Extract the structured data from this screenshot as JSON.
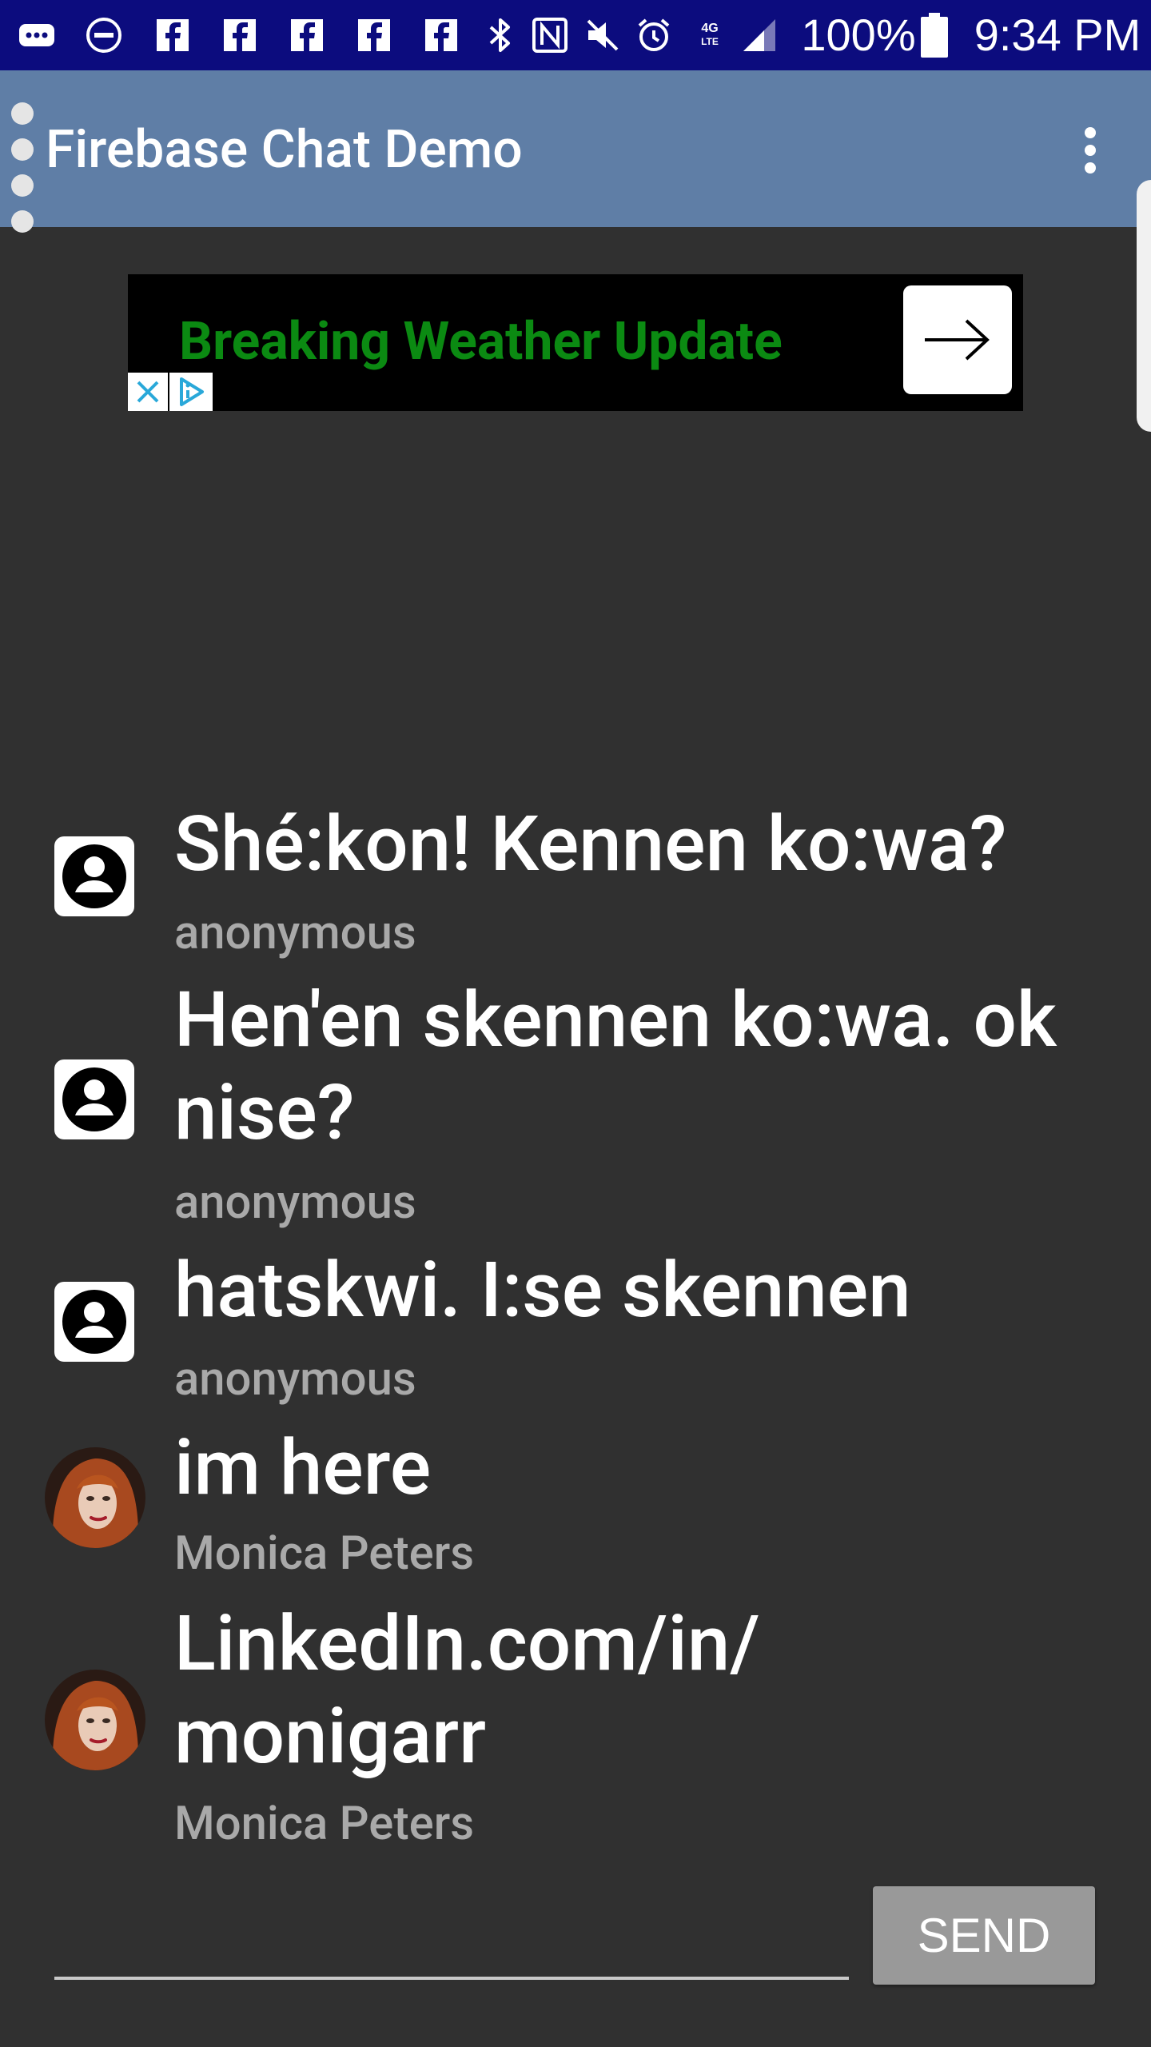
{
  "status_bar": {
    "battery": "100%",
    "time": "9:34 PM",
    "network": "4G LTE",
    "icons": [
      "message-icon",
      "do-not-disturb-icon",
      "facebook-icon",
      "facebook-icon",
      "facebook-icon",
      "facebook-icon",
      "facebook-icon",
      "bluetooth-icon",
      "nfc-icon",
      "mute-icon",
      "alarm-icon",
      "network-4g-icon",
      "signal-icon",
      "battery-icon"
    ]
  },
  "app_bar": {
    "title": "Firebase Chat Demo",
    "menu_icon": "overflow-menu-icon"
  },
  "ad": {
    "text": "Breaking Weather Update",
    "text_color": "#0b8a12",
    "arrow_icon": "arrow-right-icon",
    "close_icon": "close-icon",
    "adchoices_icon": "adchoices-icon"
  },
  "messages": [
    {
      "text": "Shé:kon! Kennen ko:wa?",
      "author": "anonymous",
      "avatar": "default-user-icon"
    },
    {
      "text": "Hen'en skennen ko:wa. ok nise?",
      "author": "anonymous",
      "avatar": "default-user-icon"
    },
    {
      "text": "hatskwi. I:se skennen",
      "author": "anonymous",
      "avatar": "default-user-icon"
    },
    {
      "text": "im here",
      "author": "Monica Peters",
      "avatar": "user-photo"
    },
    {
      "text": "LinkedIn.com/in/\nmonigarr",
      "author": "Monica Peters",
      "avatar": "user-photo"
    }
  ],
  "composer": {
    "input_value": "",
    "send_label": "SEND"
  },
  "colors": {
    "status_bar": "#0c0c7e",
    "app_bar": "#5f7ea6",
    "background": "#303030",
    "author_text": "#a9a9a9",
    "send_button": "#999999"
  }
}
